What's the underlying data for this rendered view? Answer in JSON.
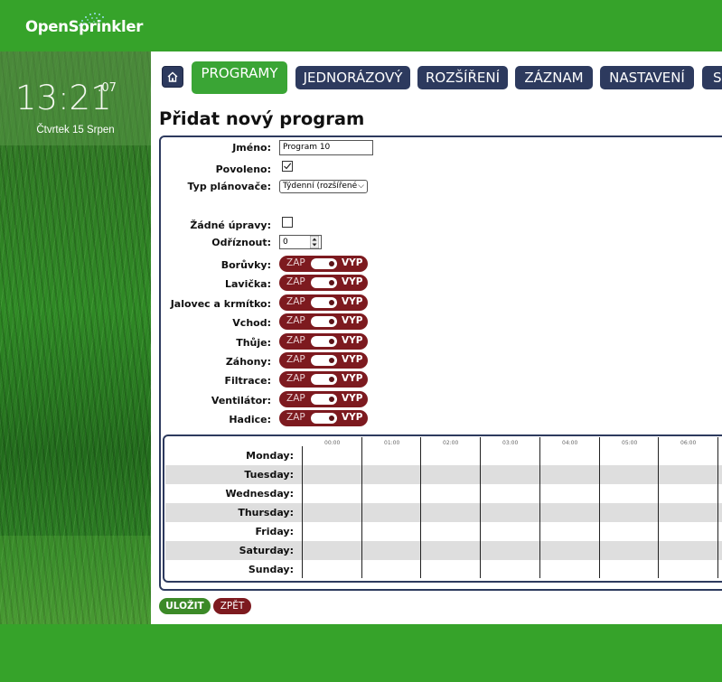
{
  "app": {
    "logo": "OpenSprinkler"
  },
  "clock": {
    "time": "13:21",
    "seconds": ":07",
    "date": "Čtvrtek 15 Srpen"
  },
  "nav": {
    "home": "home",
    "tabs": [
      "PROGRAMY",
      "JEDNORÁZOVÝ",
      "ROZŠÍŘENÍ",
      "ZÁZNAM",
      "NASTAVENÍ",
      "S"
    ],
    "active": "PROGRAMY"
  },
  "page": {
    "title": "Přidat nový program"
  },
  "form": {
    "name_label": "Jméno:",
    "name_value": "Program 10",
    "enabled_label": "Povoleno:",
    "enabled": true,
    "schedule_type_label": "Typ plánovače:",
    "schedule_type_value": "Týdenní (rozšířené",
    "no_adjust_label": "Žádné úpravy:",
    "no_adjust": false,
    "cutoff_label": "Odříznout:",
    "cutoff_value": "0"
  },
  "toggle_labels": {
    "on": "ZAP",
    "off": "VYP"
  },
  "zones": [
    {
      "label": "Borůvky:",
      "state": "VYP"
    },
    {
      "label": "Lavička:",
      "state": "VYP"
    },
    {
      "label": "Jalovec a krmítko:",
      "state": "VYP"
    },
    {
      "label": "Vchod:",
      "state": "VYP"
    },
    {
      "label": "Thůje:",
      "state": "VYP"
    },
    {
      "label": "Záhony:",
      "state": "VYP"
    },
    {
      "label": "Filtrace:",
      "state": "VYP"
    },
    {
      "label": "Ventilátor:",
      "state": "VYP"
    },
    {
      "label": "Hadice:",
      "state": "VYP"
    }
  ],
  "week": {
    "hours": [
      "00:00",
      "01:00",
      "02:00",
      "03:00",
      "04:00",
      "05:00",
      "06:00"
    ],
    "days": [
      "Monday:",
      "Tuesday:",
      "Wednesday:",
      "Thursday:",
      "Friday:",
      "Saturday:",
      "Sunday:"
    ]
  },
  "buttons": {
    "save": "ULOŽIT",
    "back": "ZPĚT"
  },
  "colors": {
    "brand_green": "#36a32a",
    "nav_navy": "#2d3a5e",
    "toggle_red": "#7d1a1f",
    "save_green": "#3c8a28"
  }
}
